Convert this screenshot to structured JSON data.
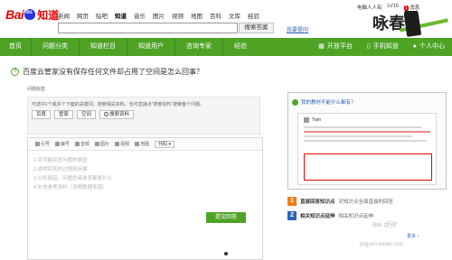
{
  "brand": {
    "bai": "Bai",
    "zhidao": "知道"
  },
  "topnav": [
    "新闻",
    "网页",
    "贴吧",
    "知道",
    "音乐",
    "图片",
    "视频",
    "地图",
    "百科",
    "文库",
    "经验"
  ],
  "topnav_active": 3,
  "search": {
    "button": "搜索答案",
    "hint_link": "我要提问",
    "value": ""
  },
  "user": {
    "name": "电脑人人有",
    "level": "LV15",
    "msg": "消息",
    "msg_count": "1"
  },
  "hero_char": "咏春",
  "greennav": {
    "items": [
      "首页",
      "问题分类",
      "知道栏目",
      "知道用户",
      "咨询专家",
      "经验"
    ],
    "right": [
      "开放平台",
      "手机知道",
      "个人中心"
    ]
  },
  "question": {
    "icon": "?",
    "title": "百度云管家没有保存任何文件却占用了空间是怎么回事？",
    "tags_label": "问题标签"
  },
  "tagbox": {
    "hint": "可选中1个或多个下面的关键词，搜索相关资料。也可直接点“搜索资料”搜索整个问题。",
    "buttons": [
      "百度",
      "管家",
      "空间",
      "搜索资料"
    ]
  },
  "editor": {
    "toolbar": [
      "引号",
      "编号",
      "音频",
      "图片",
      "视频",
      "地图"
    ],
    "code_select": "代码",
    "lines": [
      "1.尽可能回答问题的原因",
      "2.说明回答的过程和步骤",
      "3.分析原因，问题的具体答案是什么",
      "4.补充参考资料（说明数据来源）"
    ],
    "submit": "提交回答"
  },
  "panel": {
    "card_title": "我的教材不能什么都有？",
    "card_user": "Yam",
    "features": [
      {
        "num": "1",
        "title": "直接回答知识点",
        "desc": "对知识点全面直接的回答",
        "color": "#f07c17"
      },
      {
        "num": "2",
        "title": "相关知识点延伸",
        "desc": "相关知识点延伸",
        "color": "#2d64b3"
      }
    ],
    "more": "更多 ›"
  },
  "watermark": {
    "logo": "Bai 经验",
    "url": "jingyan.baidu.com"
  }
}
